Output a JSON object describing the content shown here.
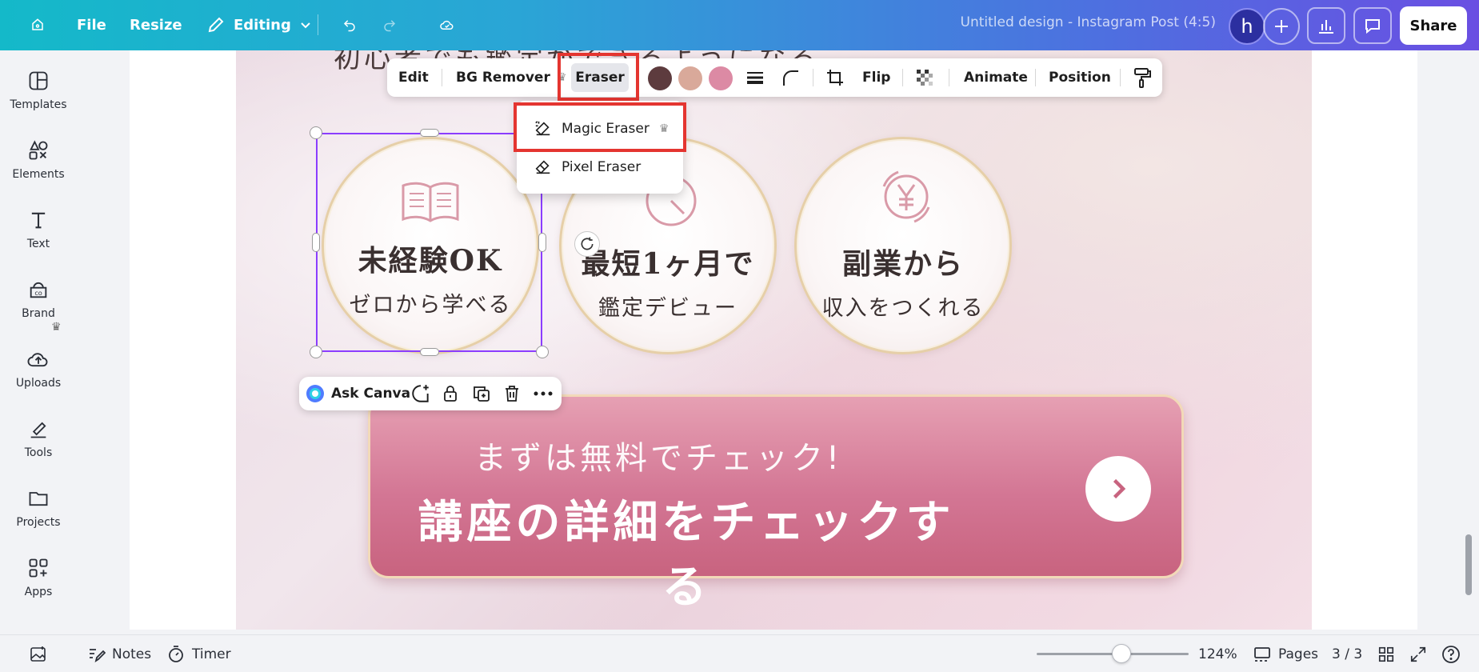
{
  "topbar": {
    "file": "File",
    "resize": "Resize",
    "editing": "Editing",
    "title": "Untitled design - Instagram Post (4:5)",
    "avatar_initial": "h",
    "share": "Share"
  },
  "sidebar": {
    "items": [
      {
        "label": "Templates",
        "icon": "templates-icon"
      },
      {
        "label": "Elements",
        "icon": "elements-icon"
      },
      {
        "label": "Text",
        "icon": "text-icon"
      },
      {
        "label": "Brand",
        "icon": "brand-icon"
      },
      {
        "label": "Uploads",
        "icon": "uploads-icon"
      },
      {
        "label": "Tools",
        "icon": "tools-icon"
      },
      {
        "label": "Projects",
        "icon": "projects-icon"
      },
      {
        "label": "Apps",
        "icon": "apps-icon"
      }
    ]
  },
  "toolbar": {
    "edit": "Edit",
    "bg_remover": "BG Remover",
    "eraser": "Eraser",
    "flip": "Flip",
    "animate": "Animate",
    "position": "Position",
    "swatches": [
      "#5d3b3e",
      "#d9a99a",
      "#dc8aa4"
    ]
  },
  "eraser_menu": {
    "magic_eraser": "Magic Eraser",
    "pixel_eraser": "Pixel Eraser"
  },
  "ask_bar": {
    "ask_canva": "Ask Canva"
  },
  "design": {
    "top_text": "初心者でも鑑定ができるようになる。",
    "circles": [
      {
        "line1": "未経験OK",
        "line2": "ゼロから学べる"
      },
      {
        "line1": "最短1ヶ月で",
        "line2": "鑑定デビュー"
      },
      {
        "line1": "副業から",
        "line2": "収入をつくれる"
      }
    ],
    "cta_sub": "まずは無料でチェック!",
    "cta_main": "講座の詳細をチェックする"
  },
  "bottombar": {
    "notes": "Notes",
    "timer": "Timer",
    "zoom": "124%",
    "zoom_fraction": 0.56,
    "pages": "Pages",
    "page_count": "3 / 3"
  },
  "colors": {
    "accent_purple": "#8b3dff",
    "highlight_red": "#e43530",
    "cta_pink": "#d37694"
  }
}
